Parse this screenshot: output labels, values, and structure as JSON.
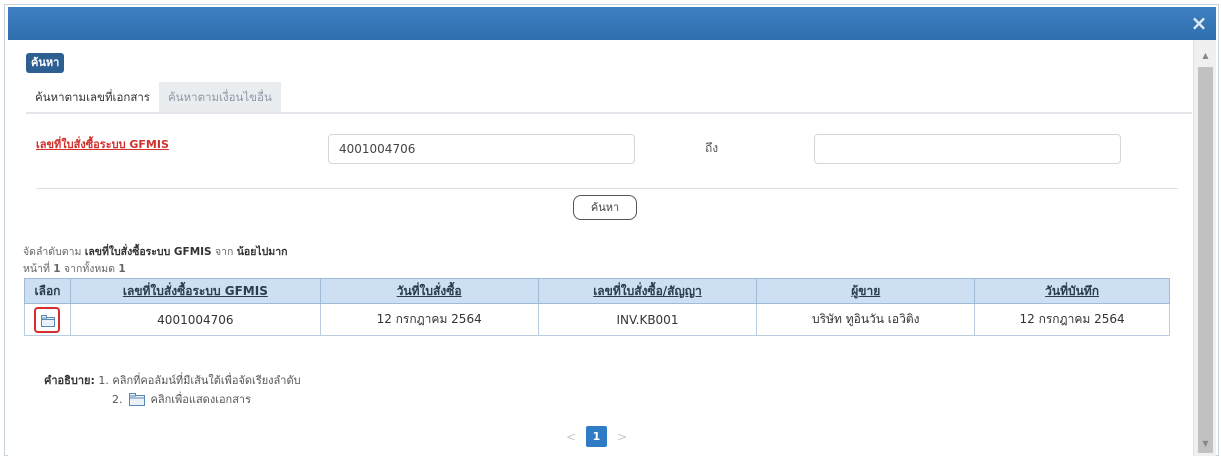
{
  "dialog": {
    "close_glyph": "×"
  },
  "search_badge": "ค้นหา",
  "tabs": [
    {
      "label": "ค้นหาตามเลขที่เอกสาร",
      "active": true
    },
    {
      "label": "ค้นหาตามเงื่อนไขอื่น",
      "active": false
    }
  ],
  "form": {
    "gfmis_label": "เลขที่ใบสั่งซื้อระบบ GFMIS",
    "gfmis_value": "4001004706",
    "to_label": "ถึง",
    "to_value": ""
  },
  "search_button": "ค้นหา",
  "sort": {
    "prefix": "จัดลำดับตาม ",
    "field": "เลขที่ใบสั่งซื้อระบบ GFMIS",
    "middle": " จาก ",
    "order": "น้อยไปมาก"
  },
  "page_info": {
    "prefix": "หน้าที่ ",
    "page": "1",
    "middle": " จากทั้งหมด ",
    "total": "1"
  },
  "table": {
    "headers": [
      "เลือก",
      "เลขที่ใบสั่งซื้อระบบ GFMIS",
      "วันที่ใบสั่งซื้อ",
      "เลขที่ใบสั่งซื้อ/สัญญา",
      "ผู้ขาย",
      "วันที่บันทึก"
    ],
    "rows": [
      {
        "select_icon": "folder-icon",
        "gfmis": "4001004706",
        "po_date": "12 กรกฎาคม 2564",
        "po_contract": "INV.KB001",
        "vendor": "บริษัท ทูอินวัน เอวิติง",
        "record_date": "12 กรกฎาคม 2564"
      }
    ]
  },
  "explanation": {
    "title": "คำอธิบาย:",
    "line1": "1. คลิกที่คอลัมน์ที่มีเส้นใต้เพื่อจัดเรียงลำดับ",
    "line2_num": "2.",
    "line2_text": "คลิกเพื่อแสดงเอกสาร"
  },
  "pager": {
    "prev": "<",
    "current": "1",
    "next": ">"
  },
  "colors": {
    "titlebar": "#2f6fae",
    "header_bg": "#cde0f3",
    "link_red": "#d0312d",
    "page_active": "#2f7cc4"
  }
}
